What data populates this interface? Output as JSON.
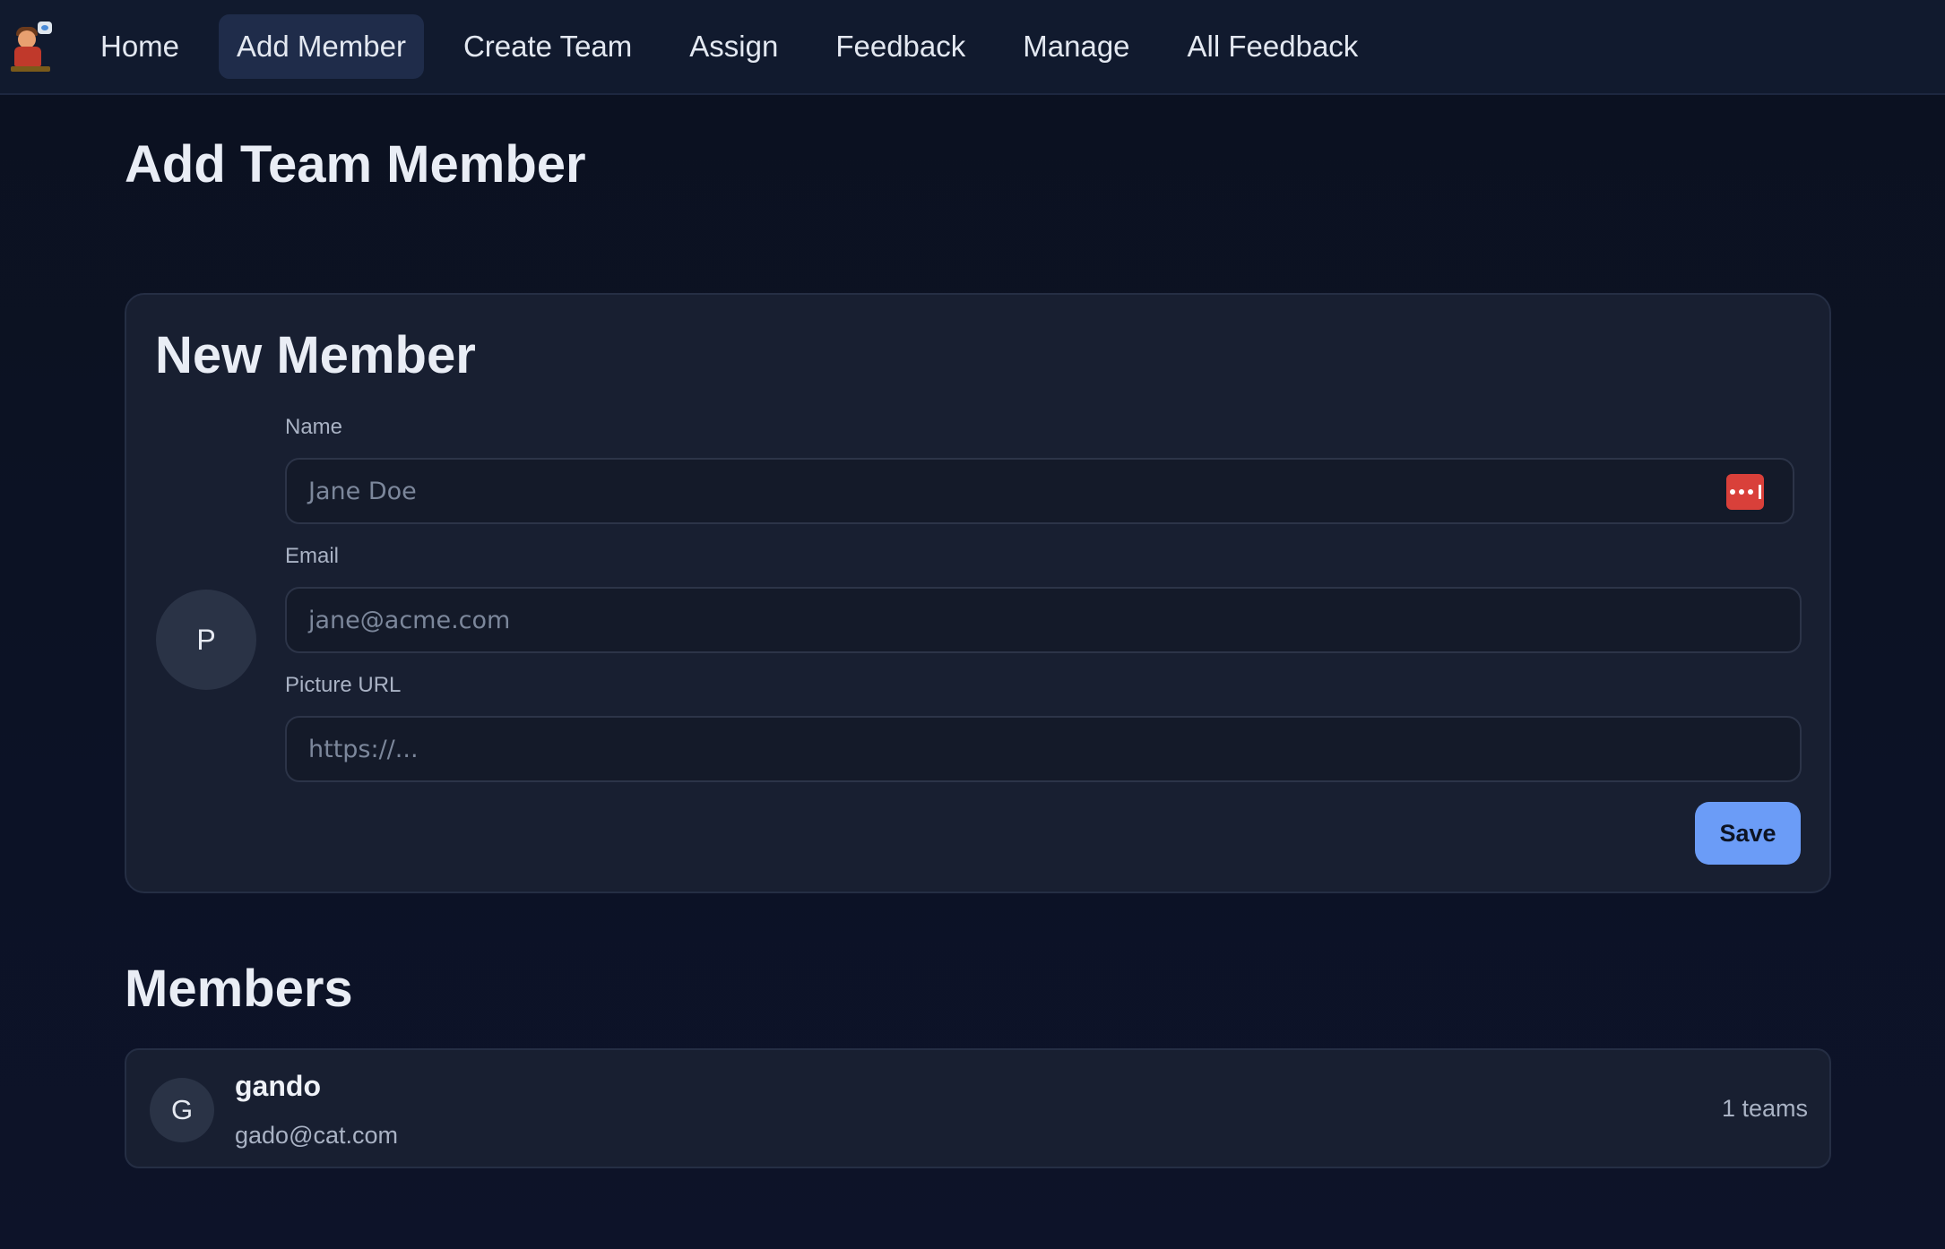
{
  "nav": {
    "items": [
      {
        "label": "Home",
        "active": false
      },
      {
        "label": "Add Member",
        "active": true
      },
      {
        "label": "Create Team",
        "active": false
      },
      {
        "label": "Assign",
        "active": false
      },
      {
        "label": "Feedback",
        "active": false
      },
      {
        "label": "Manage",
        "active": false
      },
      {
        "label": "All Feedback",
        "active": false
      }
    ]
  },
  "page": {
    "title": "Add Team Member"
  },
  "form": {
    "title": "New Member",
    "avatar_initial": "P",
    "name": {
      "label": "Name",
      "placeholder": "Jane Doe",
      "value": ""
    },
    "email": {
      "label": "Email",
      "placeholder": "jane@acme.com",
      "value": ""
    },
    "picture": {
      "label": "Picture URL",
      "placeholder": "https://...",
      "value": ""
    },
    "save_label": "Save",
    "password_manager_icon": "password-manager-icon"
  },
  "members": {
    "title": "Members",
    "list": [
      {
        "initial": "G",
        "name": "gando",
        "email": "gado@cat.com",
        "teams": "1 teams"
      }
    ]
  },
  "colors": {
    "background": "#0b1120",
    "nav_bg": "#111a2e",
    "card_bg": "#181f31",
    "accent": "#6b9cf7",
    "active_nav": "#1f2c4a",
    "password_icon": "#d9403a"
  }
}
